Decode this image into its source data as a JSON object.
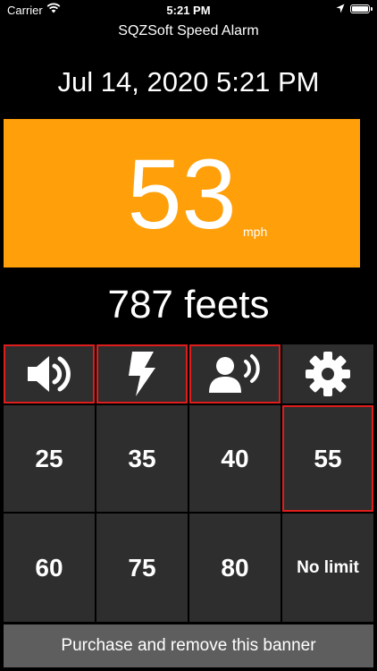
{
  "status_bar": {
    "carrier": "Carrier",
    "time": "5:21 PM",
    "icons": [
      "wifi-icon",
      "location-arrow-icon",
      "battery-icon"
    ]
  },
  "header": {
    "app_title": "SQZSoft Speed Alarm",
    "datetime": "Jul 14, 2020 5:21 PM"
  },
  "speed": {
    "value": "53",
    "unit": "mph",
    "panel_color": "#ff9f0a"
  },
  "distance": "787 feets",
  "controls": {
    "toggles": [
      {
        "icon": "speaker-icon",
        "selected": true
      },
      {
        "icon": "lightning-icon",
        "selected": true
      },
      {
        "icon": "voice-icon",
        "selected": true
      },
      {
        "icon": "gear-icon",
        "selected": false
      }
    ],
    "limits": [
      {
        "label": "25",
        "selected": false
      },
      {
        "label": "35",
        "selected": false
      },
      {
        "label": "40",
        "selected": false
      },
      {
        "label": "55",
        "selected": true
      },
      {
        "label": "60",
        "selected": false
      },
      {
        "label": "75",
        "selected": false
      },
      {
        "label": "80",
        "selected": false
      },
      {
        "label": "No limit",
        "selected": false
      }
    ],
    "selected_border_color": "#e01d1d"
  },
  "banner": {
    "text": "Purchase and remove this banner"
  }
}
